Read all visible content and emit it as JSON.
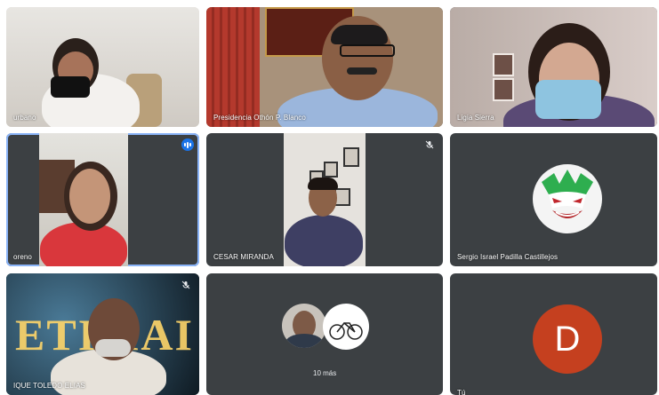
{
  "participants": [
    {
      "name": "urbano",
      "muted": false
    },
    {
      "name": "Presidencia Othón P. Blanco",
      "muted": false
    },
    {
      "name": "Ligia Sierra",
      "muted": false
    },
    {
      "name": "oreno",
      "speaking": true
    },
    {
      "name": "CESAR MIRANDA",
      "muted": true
    },
    {
      "name": "Sergio Israel Padilla Castillejos",
      "muted": false
    },
    {
      "name": "IQUE TOLEDO ELIAS",
      "muted": true
    },
    {
      "name": "Tú",
      "avatar_letter": "D"
    }
  ],
  "overflow": {
    "label": "10 más"
  },
  "colors": {
    "tile_bg": "#3c4043",
    "active_border": "#8ab4f8",
    "speaking_badge": "#1a73e8",
    "avatar_D": "#c5401f"
  },
  "icons": [
    "mic-off-icon",
    "speaking-indicator-icon",
    "joker-avatar",
    "bicycle-avatar"
  ]
}
